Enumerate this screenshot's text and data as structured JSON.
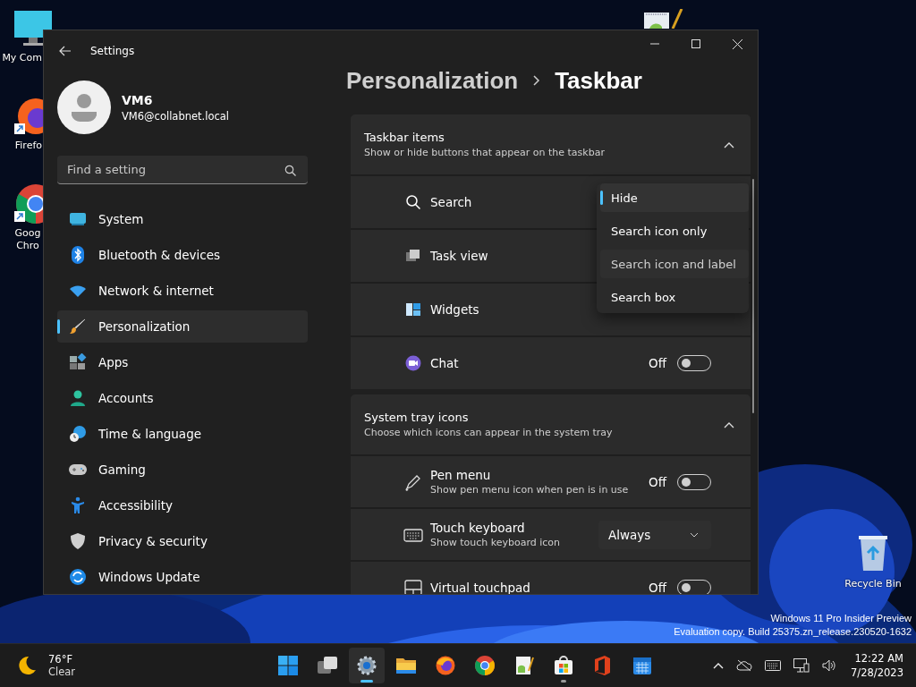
{
  "desktop_icons": [
    {
      "label": "My Com"
    },
    {
      "label": "Firefo"
    },
    {
      "label": "Goog Chro"
    },
    {
      "label": "Recycle Bin"
    }
  ],
  "window": {
    "title": "Settings"
  },
  "profile": {
    "name": "VM6",
    "email": "VM6@collabnet.local"
  },
  "search": {
    "placeholder": "Find a setting"
  },
  "nav": [
    {
      "label": "System",
      "selected": false
    },
    {
      "label": "Bluetooth & devices",
      "selected": false
    },
    {
      "label": "Network & internet",
      "selected": false
    },
    {
      "label": "Personalization",
      "selected": true
    },
    {
      "label": "Apps",
      "selected": false
    },
    {
      "label": "Accounts",
      "selected": false
    },
    {
      "label": "Time & language",
      "selected": false
    },
    {
      "label": "Gaming",
      "selected": false
    },
    {
      "label": "Accessibility",
      "selected": false
    },
    {
      "label": "Privacy & security",
      "selected": false
    },
    {
      "label": "Windows Update",
      "selected": false
    }
  ],
  "breadcrumb": [
    "Personalization",
    "Taskbar"
  ],
  "sections": [
    {
      "title": "Taskbar items",
      "subtitle": "Show or hide buttons that appear on the taskbar",
      "expanded": true,
      "rows": [
        {
          "kind": "menu",
          "label": "Search",
          "options": [
            {
              "label": "Hide",
              "selected": true,
              "hovered": false
            },
            {
              "label": "Search icon only",
              "selected": false,
              "hovered": false
            },
            {
              "label": "Search icon and label",
              "selected": false,
              "hovered": true
            },
            {
              "label": "Search box",
              "selected": false,
              "hovered": false
            }
          ]
        },
        {
          "kind": "plain",
          "label": "Task view"
        },
        {
          "kind": "plain",
          "label": "Widgets"
        },
        {
          "kind": "toggle",
          "label": "Chat",
          "state_label": "Off",
          "on": false
        }
      ]
    },
    {
      "title": "System tray icons",
      "subtitle": "Choose which icons can appear in the system tray",
      "expanded": true,
      "rows": [
        {
          "kind": "toggle",
          "label": "Pen menu",
          "description": "Show pen menu icon when pen is in use",
          "state_label": "Off",
          "on": false
        },
        {
          "kind": "select",
          "label": "Touch keyboard",
          "description": "Show touch keyboard icon",
          "value": "Always"
        },
        {
          "kind": "toggle",
          "label": "Virtual touchpad",
          "state_label": "Off",
          "on": false
        }
      ]
    }
  ],
  "watermark": [
    "Windows 11 Pro Insider Preview",
    "Evaluation copy. Build 25375.zn_release.230520-1632"
  ],
  "taskbar": {
    "weather": {
      "temperature": "76°F",
      "condition": "Clear"
    },
    "apps": [
      {
        "running": false,
        "focused": false
      },
      {
        "running": false,
        "focused": false
      },
      {
        "running": true,
        "focused": true
      },
      {
        "running": false,
        "focused": false
      },
      {
        "running": false,
        "focused": false
      },
      {
        "running": false,
        "focused": false
      },
      {
        "running": false,
        "focused": false
      },
      {
        "running": true,
        "focused": false
      },
      {
        "running": false,
        "focused": false
      },
      {
        "running": false,
        "focused": false
      }
    ],
    "clock": {
      "time": "12:22 AM",
      "date": "7/28/2023"
    }
  }
}
